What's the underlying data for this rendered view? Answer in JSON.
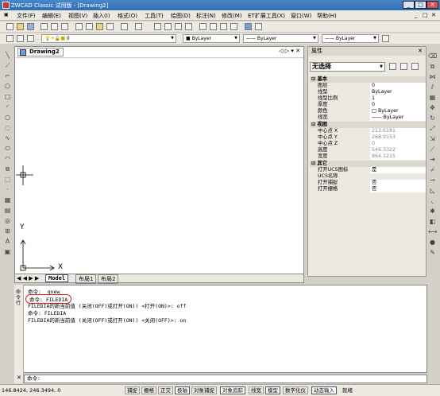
{
  "title": "ZWCAD Classic 试用版 - [Drawing2]",
  "menu": [
    "文件(F)",
    "编辑(E)",
    "视图(V)",
    "插入(I)",
    "格式(O)",
    "工具(T)",
    "绘图(D)",
    "标注(N)",
    "修改(M)",
    "ET扩展工具(X)",
    "窗口(W)",
    "帮助(H)"
  ],
  "layer_combo": "0",
  "color_combo": "ByLayer",
  "linetype_combo": "ByLayer",
  "lineweight_combo": "ByLayer",
  "drawing_tab": "Drawing2",
  "doc_controls": "◁ ▷ ▾ ✕",
  "model_tabs": {
    "nav": "◀ ◀ ▶ ▶",
    "model": "Model",
    "layout1": "布局1",
    "layout2": "布局2"
  },
  "ucs": {
    "y": "Y",
    "x": "X"
  },
  "properties": {
    "header": "属性",
    "close": "✕",
    "selection": "无选择",
    "groups": {
      "basic": "基本",
      "view": "视图",
      "other": "其它"
    },
    "basic_rows": [
      {
        "k": "图层",
        "v": "0"
      },
      {
        "k": "线型",
        "v": "ByLayer"
      },
      {
        "k": "线型比例",
        "v": "1"
      },
      {
        "k": "厚度",
        "v": "0"
      },
      {
        "k": "颜色",
        "v": "□ ByLayer"
      },
      {
        "k": "线宽",
        "v": "—— ByLayer"
      }
    ],
    "view_rows": [
      {
        "k": "中心点 X",
        "v": "213.6181"
      },
      {
        "k": "中心点 Y",
        "v": "268.9153"
      },
      {
        "k": "中心点 Z",
        "v": "0"
      },
      {
        "k": "高度",
        "v": "546.3322"
      },
      {
        "k": "宽度",
        "v": "864.1215"
      }
    ],
    "other_rows": [
      {
        "k": "打开UCS图标",
        "v": "是"
      },
      {
        "k": "UCS名称",
        "v": ""
      },
      {
        "k": "打开捕捉",
        "v": "否"
      },
      {
        "k": "打开栅格",
        "v": "否"
      }
    ]
  },
  "command_history": [
    "命令: _qnew",
    "命令: FILEDIA",
    "FILEDIA的新当前值 (关闭(OFF)或打开(ON)) <打开(ON)>: off",
    "命令: FILEDIA",
    "FILEDIA的新当前值 (关闭(OFF)或打开(ON)) <关闭(OFF)>: on"
  ],
  "command_side_label": "命令行",
  "command_prompt": "命令:",
  "highlight_color": "#e02020",
  "status": {
    "coords": "146.8424, 246.3494, 0",
    "buttons": [
      {
        "label": "捕捉",
        "on": false
      },
      {
        "label": "栅格",
        "on": false
      },
      {
        "label": "正交",
        "on": false
      },
      {
        "label": "极轴",
        "on": true
      },
      {
        "label": "对象捕捉",
        "on": false
      },
      {
        "label": "对象追踪",
        "on": true
      },
      {
        "label": "线宽",
        "on": false
      },
      {
        "label": "模型",
        "on": true
      },
      {
        "label": "数字化仪",
        "on": false
      },
      {
        "label": "动态输入",
        "on": true
      },
      {
        "label": "就绪",
        "on": false
      }
    ]
  }
}
